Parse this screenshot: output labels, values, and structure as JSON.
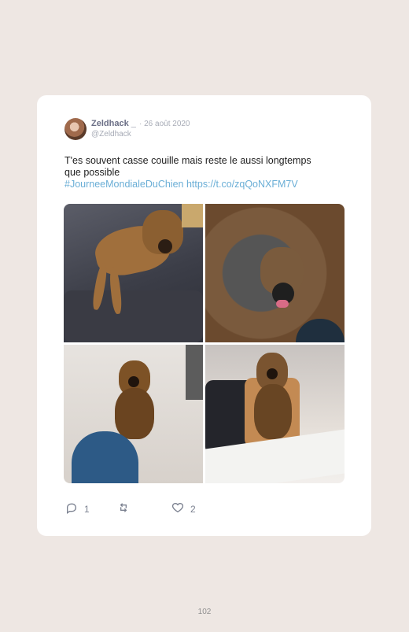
{
  "tweet": {
    "author_name": "Zeldhack _",
    "date": "· 26 août 2020",
    "handle": "@Zeldhack",
    "text_line1": "T'es souvent casse couille mais reste le aussi longtemps",
    "text_line2": "que possible",
    "hashtag": "#JourneeMondialeDuChien",
    "link": "https://t.co/zqQoNXFM7V",
    "replies": "1",
    "likes": "2"
  },
  "page": {
    "number": "102"
  }
}
